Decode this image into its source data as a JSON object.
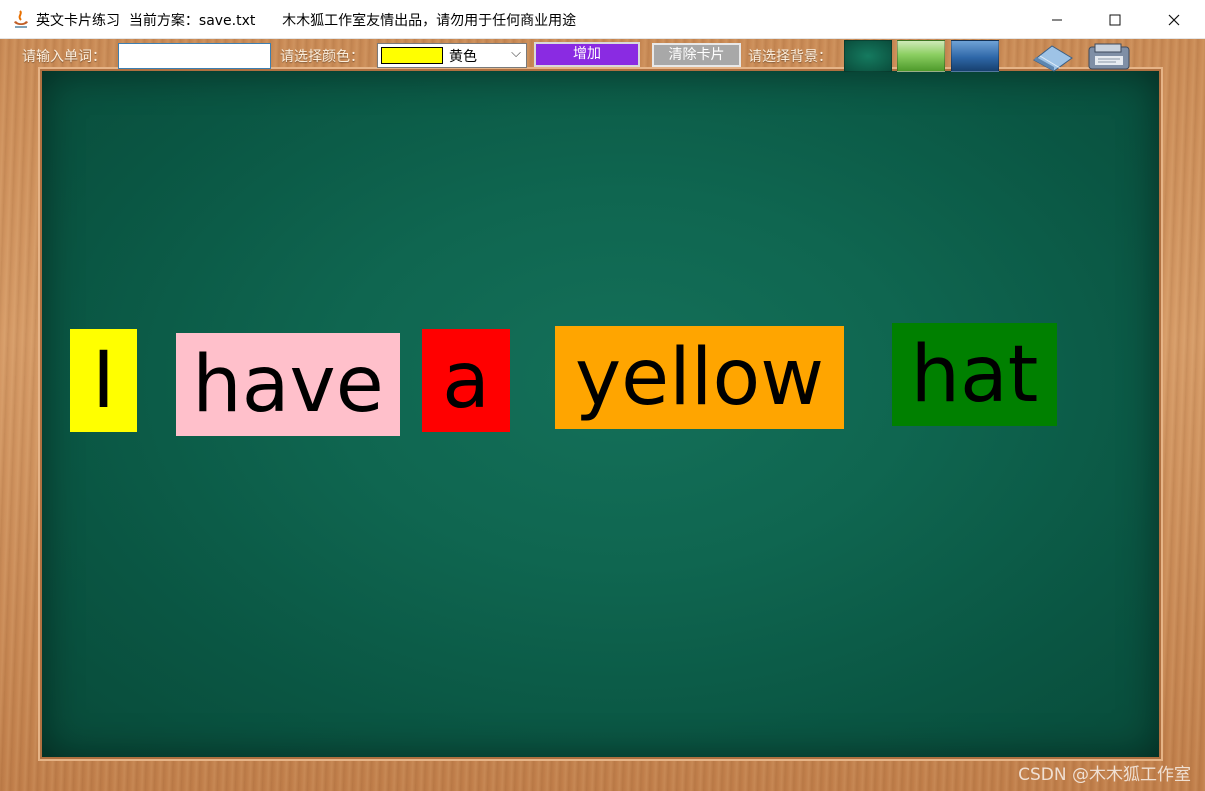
{
  "window": {
    "title": "英文卡片练习  当前方案：save.txt      木木狐工作室友情出品，请勿用于任何商业用途",
    "minimize_label": "—",
    "maximize_label": "☐",
    "close_label": "✕"
  },
  "toolbar": {
    "word_label": "请输入单词：",
    "word_value": "",
    "color_label": "请选择颜色：",
    "selected_color_name": "黄色",
    "selected_color_hex": "#ffff00",
    "add_label": "增加",
    "clear_label": "清除卡片",
    "background_label": "请选择背景："
  },
  "cards": [
    {
      "word": "I",
      "color": "#ffff00"
    },
    {
      "word": "have",
      "color": "#ffc0cb"
    },
    {
      "word": "a",
      "color": "#ff0000"
    },
    {
      "word": "yellow",
      "color": "#ffa500"
    },
    {
      "word": "hat",
      "color": "#008000"
    }
  ],
  "watermark": "CSDN @木木狐工作室"
}
